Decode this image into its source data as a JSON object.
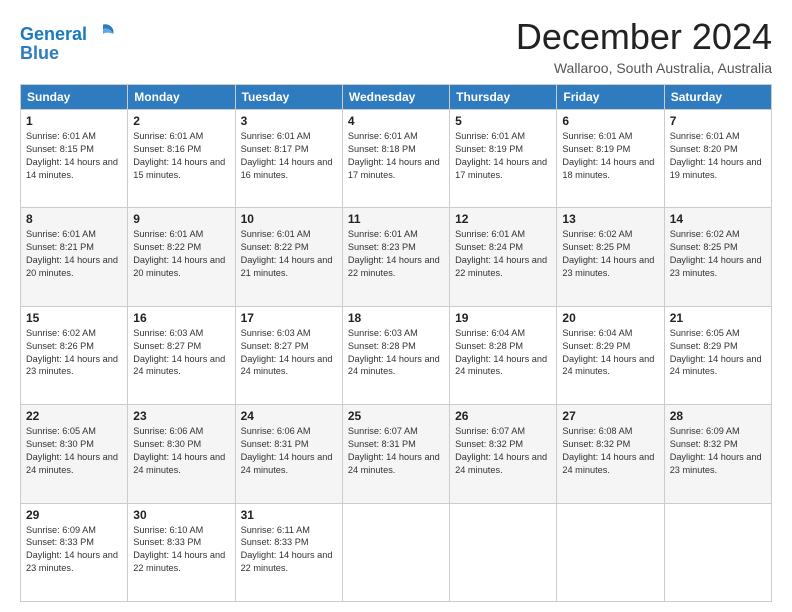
{
  "logo": {
    "line1": "General",
    "line2": "Blue"
  },
  "title": "December 2024",
  "subtitle": "Wallaroo, South Australia, Australia",
  "weekdays": [
    "Sunday",
    "Monday",
    "Tuesday",
    "Wednesday",
    "Thursday",
    "Friday",
    "Saturday"
  ],
  "weeks": [
    [
      {
        "day": "1",
        "sunrise": "6:01 AM",
        "sunset": "8:15 PM",
        "daylight": "14 hours and 14 minutes."
      },
      {
        "day": "2",
        "sunrise": "6:01 AM",
        "sunset": "8:16 PM",
        "daylight": "14 hours and 15 minutes."
      },
      {
        "day": "3",
        "sunrise": "6:01 AM",
        "sunset": "8:17 PM",
        "daylight": "14 hours and 16 minutes."
      },
      {
        "day": "4",
        "sunrise": "6:01 AM",
        "sunset": "8:18 PM",
        "daylight": "14 hours and 17 minutes."
      },
      {
        "day": "5",
        "sunrise": "6:01 AM",
        "sunset": "8:19 PM",
        "daylight": "14 hours and 17 minutes."
      },
      {
        "day": "6",
        "sunrise": "6:01 AM",
        "sunset": "8:19 PM",
        "daylight": "14 hours and 18 minutes."
      },
      {
        "day": "7",
        "sunrise": "6:01 AM",
        "sunset": "8:20 PM",
        "daylight": "14 hours and 19 minutes."
      }
    ],
    [
      {
        "day": "8",
        "sunrise": "6:01 AM",
        "sunset": "8:21 PM",
        "daylight": "14 hours and 20 minutes."
      },
      {
        "day": "9",
        "sunrise": "6:01 AM",
        "sunset": "8:22 PM",
        "daylight": "14 hours and 20 minutes."
      },
      {
        "day": "10",
        "sunrise": "6:01 AM",
        "sunset": "8:22 PM",
        "daylight": "14 hours and 21 minutes."
      },
      {
        "day": "11",
        "sunrise": "6:01 AM",
        "sunset": "8:23 PM",
        "daylight": "14 hours and 22 minutes."
      },
      {
        "day": "12",
        "sunrise": "6:01 AM",
        "sunset": "8:24 PM",
        "daylight": "14 hours and 22 minutes."
      },
      {
        "day": "13",
        "sunrise": "6:02 AM",
        "sunset": "8:25 PM",
        "daylight": "14 hours and 23 minutes."
      },
      {
        "day": "14",
        "sunrise": "6:02 AM",
        "sunset": "8:25 PM",
        "daylight": "14 hours and 23 minutes."
      }
    ],
    [
      {
        "day": "15",
        "sunrise": "6:02 AM",
        "sunset": "8:26 PM",
        "daylight": "14 hours and 23 minutes."
      },
      {
        "day": "16",
        "sunrise": "6:03 AM",
        "sunset": "8:27 PM",
        "daylight": "14 hours and 24 minutes."
      },
      {
        "day": "17",
        "sunrise": "6:03 AM",
        "sunset": "8:27 PM",
        "daylight": "14 hours and 24 minutes."
      },
      {
        "day": "18",
        "sunrise": "6:03 AM",
        "sunset": "8:28 PM",
        "daylight": "14 hours and 24 minutes."
      },
      {
        "day": "19",
        "sunrise": "6:04 AM",
        "sunset": "8:28 PM",
        "daylight": "14 hours and 24 minutes."
      },
      {
        "day": "20",
        "sunrise": "6:04 AM",
        "sunset": "8:29 PM",
        "daylight": "14 hours and 24 minutes."
      },
      {
        "day": "21",
        "sunrise": "6:05 AM",
        "sunset": "8:29 PM",
        "daylight": "14 hours and 24 minutes."
      }
    ],
    [
      {
        "day": "22",
        "sunrise": "6:05 AM",
        "sunset": "8:30 PM",
        "daylight": "14 hours and 24 minutes."
      },
      {
        "day": "23",
        "sunrise": "6:06 AM",
        "sunset": "8:30 PM",
        "daylight": "14 hours and 24 minutes."
      },
      {
        "day": "24",
        "sunrise": "6:06 AM",
        "sunset": "8:31 PM",
        "daylight": "14 hours and 24 minutes."
      },
      {
        "day": "25",
        "sunrise": "6:07 AM",
        "sunset": "8:31 PM",
        "daylight": "14 hours and 24 minutes."
      },
      {
        "day": "26",
        "sunrise": "6:07 AM",
        "sunset": "8:32 PM",
        "daylight": "14 hours and 24 minutes."
      },
      {
        "day": "27",
        "sunrise": "6:08 AM",
        "sunset": "8:32 PM",
        "daylight": "14 hours and 24 minutes."
      },
      {
        "day": "28",
        "sunrise": "6:09 AM",
        "sunset": "8:32 PM",
        "daylight": "14 hours and 23 minutes."
      }
    ],
    [
      {
        "day": "29",
        "sunrise": "6:09 AM",
        "sunset": "8:33 PM",
        "daylight": "14 hours and 23 minutes."
      },
      {
        "day": "30",
        "sunrise": "6:10 AM",
        "sunset": "8:33 PM",
        "daylight": "14 hours and 22 minutes."
      },
      {
        "day": "31",
        "sunrise": "6:11 AM",
        "sunset": "8:33 PM",
        "daylight": "14 hours and 22 minutes."
      },
      null,
      null,
      null,
      null
    ]
  ]
}
